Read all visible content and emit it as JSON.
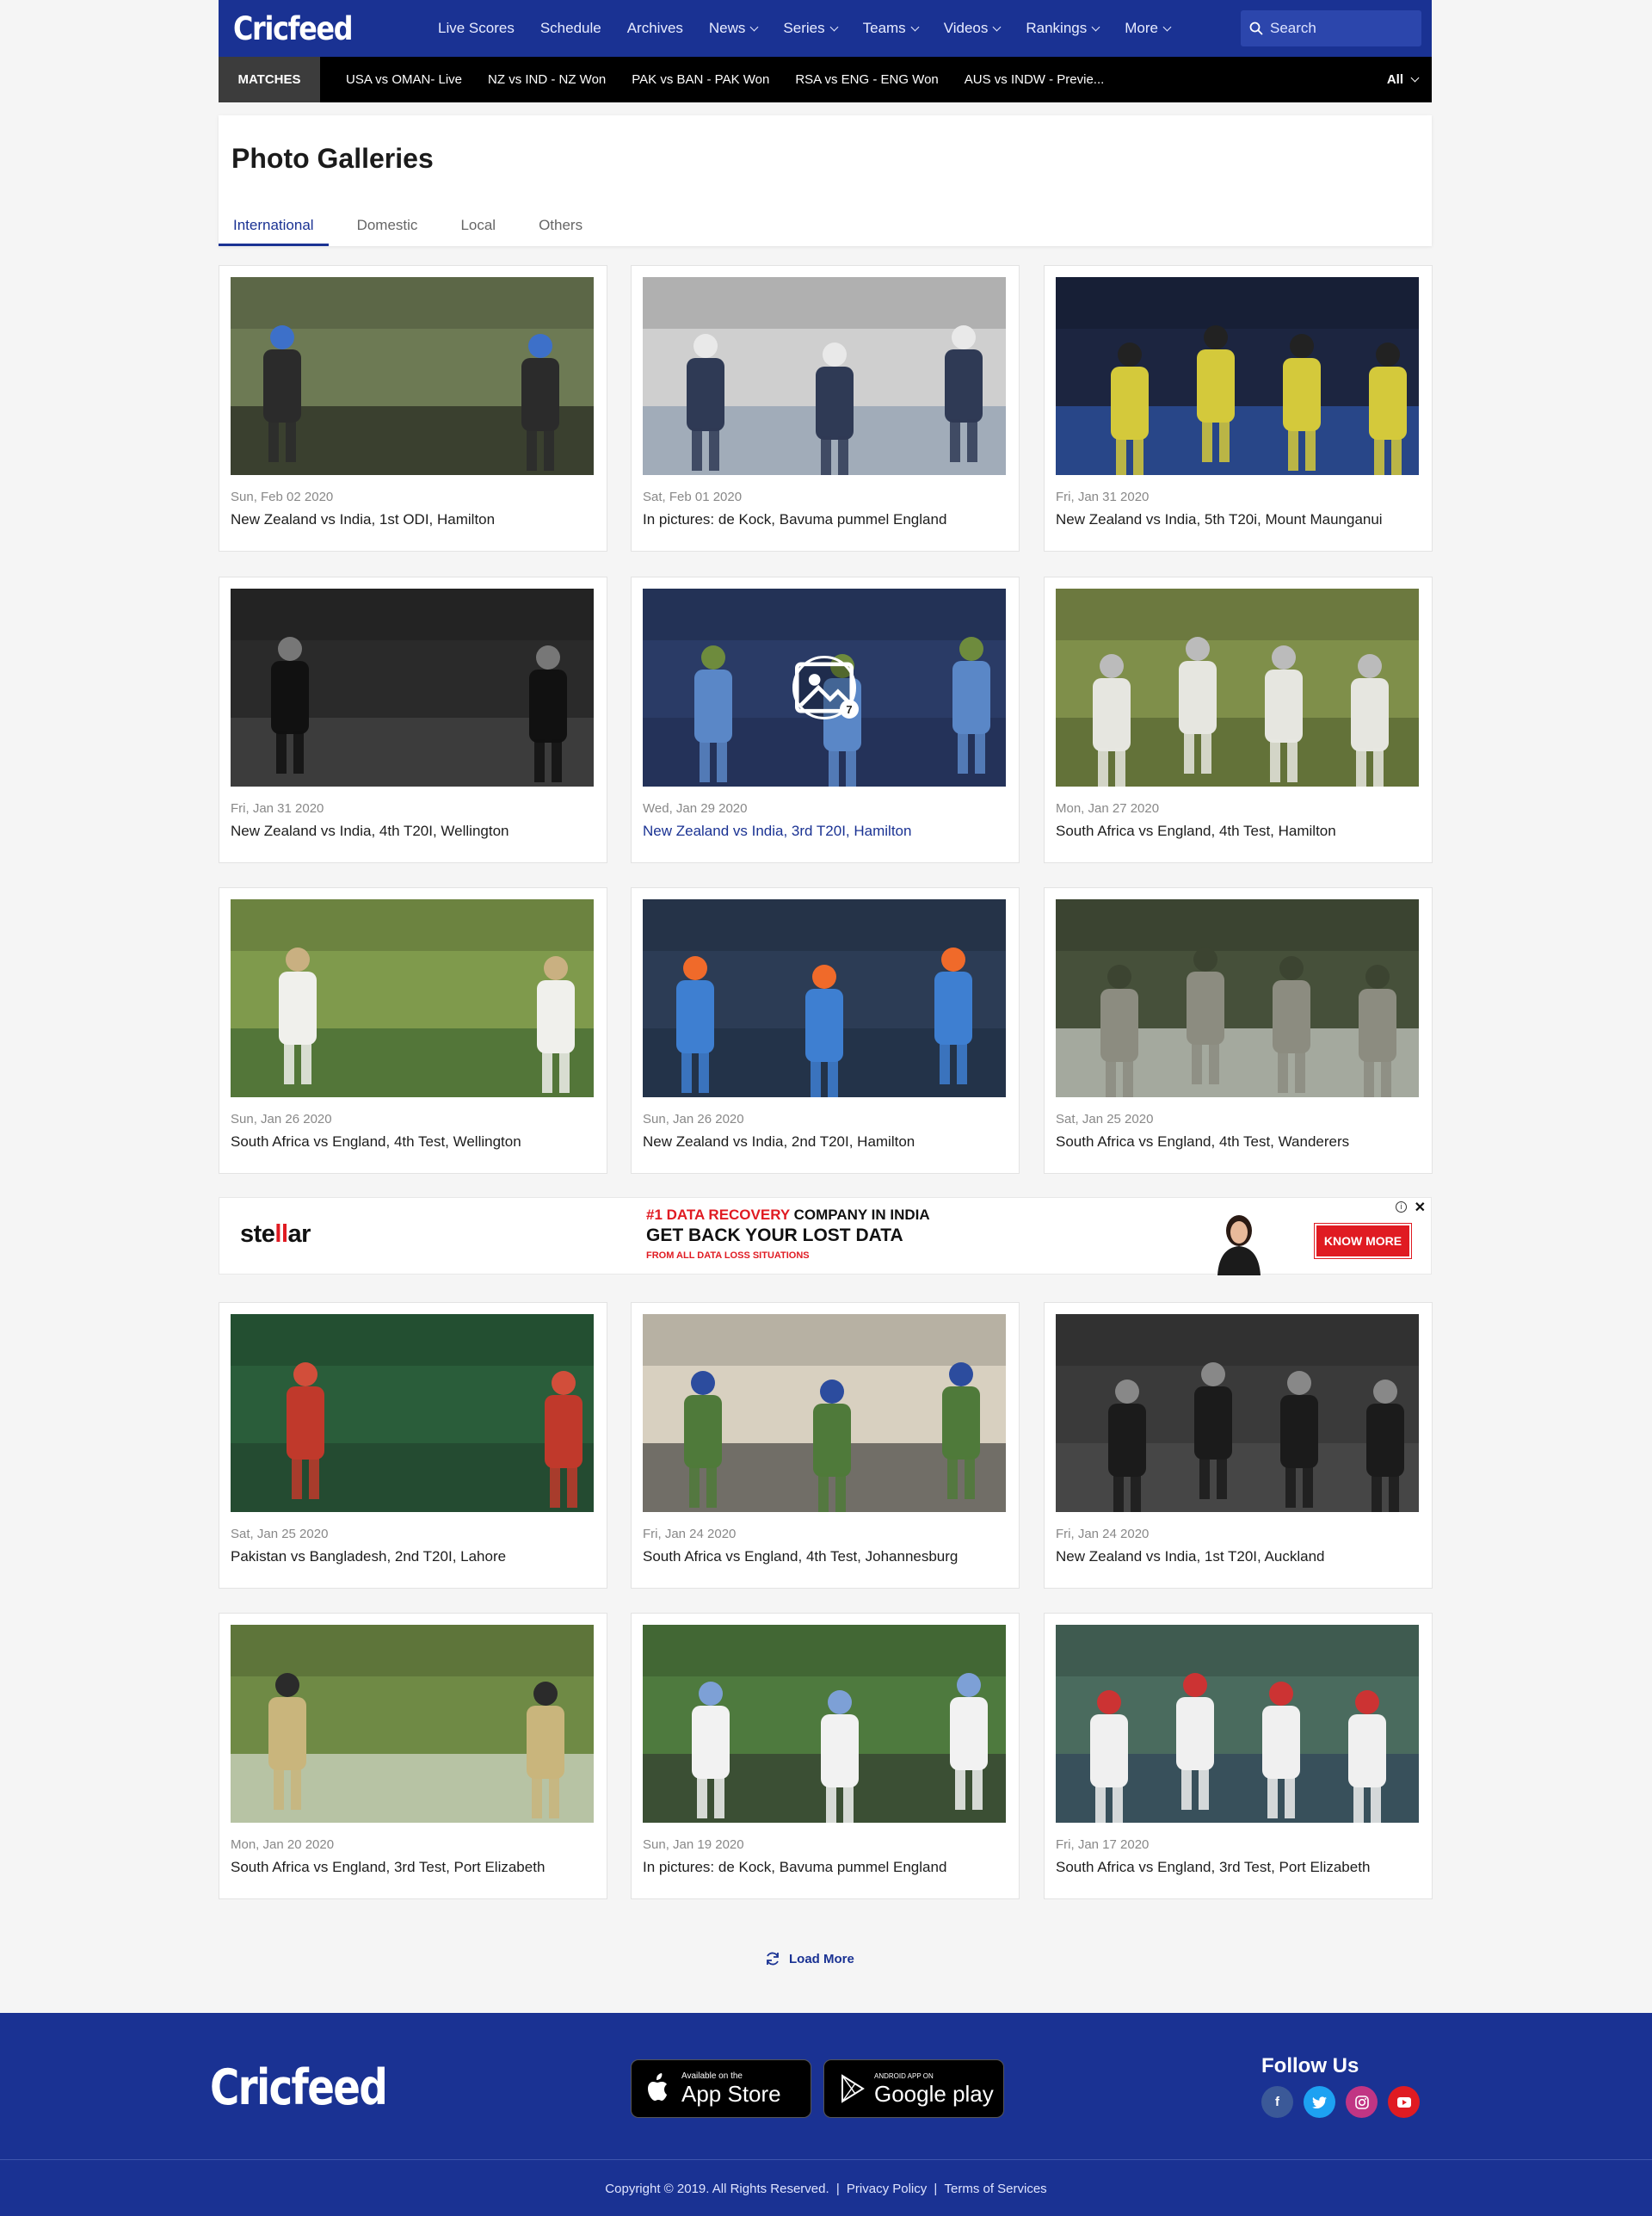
{
  "header": {
    "logo": "Cricfeed",
    "nav": [
      "Live Scores",
      "Schedule",
      "Archives",
      "News",
      "Series",
      "Teams",
      "Videos",
      "Rankings",
      "More"
    ],
    "nav_dropdowns": [
      false,
      false,
      false,
      true,
      true,
      true,
      true,
      true,
      true
    ],
    "search_placeholder": "Search"
  },
  "matches_bar": {
    "label": "MATCHES",
    "items": [
      "USA vs OMAN- Live",
      "NZ vs IND - NZ Won",
      "PAK vs BAN - PAK Won",
      "RSA vs  ENG - ENG Won",
      "AUS vs INDW - Previe..."
    ],
    "filter": "All"
  },
  "page": {
    "title": "Photo Galleries",
    "tabs": [
      "International",
      "Domestic",
      "Local",
      "Others"
    ],
    "active_tab": "International"
  },
  "galleries": [
    {
      "date": "Sun, Feb 02 2020",
      "title": "New Zealand vs India, 1st ODI, Hamilton"
    },
    {
      "date": "Sat, Feb 01 2020",
      "title": "In pictures: de Kock, Bavuma pummel England"
    },
    {
      "date": "Fri, Jan 31 2020",
      "title": "New Zealand vs India, 5th T20i, Mount Maunganui"
    },
    {
      "date": "Fri, Jan 31 2020",
      "title": "New Zealand vs India, 4th T20I, Wellington"
    },
    {
      "date": "Wed, Jan 29 2020",
      "title": "New Zealand vs India, 3rd T20I, Hamilton",
      "photo_count": "7",
      "hovered": true
    },
    {
      "date": "Mon, Jan 27 2020",
      "title": "South Africa vs England, 4th Test, Hamilton"
    },
    {
      "date": "Sun, Jan 26 2020",
      "title": "South Africa vs England, 4th Test, Wellington"
    },
    {
      "date": "Sun, Jan 26 2020",
      "title": "New Zealand vs India, 2nd T20I, Hamilton"
    },
    {
      "date": "Sat, Jan 25 2020",
      "title": "South Africa vs England, 4th Test, Wanderers"
    },
    {
      "date": "Sat, Jan 25 2020",
      "title": "Pakistan vs Bangladesh, 2nd T20I, Lahore"
    },
    {
      "date": "Fri, Jan 24 2020",
      "title": "South Africa vs England, 4th Test, Johannesburg"
    },
    {
      "date": "Fri, Jan 24 2020",
      "title": "New Zealand vs India, 1st T20I, Auckland"
    },
    {
      "date": "Mon, Jan 20 2020",
      "title": "South Africa vs England, 3rd Test, Port Elizabeth"
    },
    {
      "date": "Sun, Jan 19 2020",
      "title": "In pictures: de Kock, Bavuma pummel England"
    },
    {
      "date": "Fri, Jan 17 2020",
      "title": "South Africa vs England, 3rd Test, Port Elizabeth"
    }
  ],
  "ad": {
    "brand_a": "ste",
    "brand_b": "ll",
    "brand_c": "ar",
    "line1_red": "#1 DATA RECOVERY",
    "line1_rest": " COMPANY IN INDIA",
    "line2": "GET BACK YOUR LOST DATA",
    "line3": "FROM ALL DATA LOSS SITUATIONS",
    "button": "KNOW MORE"
  },
  "load_more": "Load More",
  "footer": {
    "logo": "Cricfeed",
    "app_store_small": "Available on the",
    "app_store_big": "App Store",
    "google_small": "ANDROID APP ON",
    "google_big": "Google play",
    "follow": "Follow Us",
    "copyright": "Copyright © 2019. All Rights Reserved.",
    "privacy": "Privacy Policy",
    "terms": "Terms of Services"
  },
  "colors": {
    "brand": "#1a3293",
    "accent_red": "#e01b22",
    "match_bar": "#000000"
  }
}
